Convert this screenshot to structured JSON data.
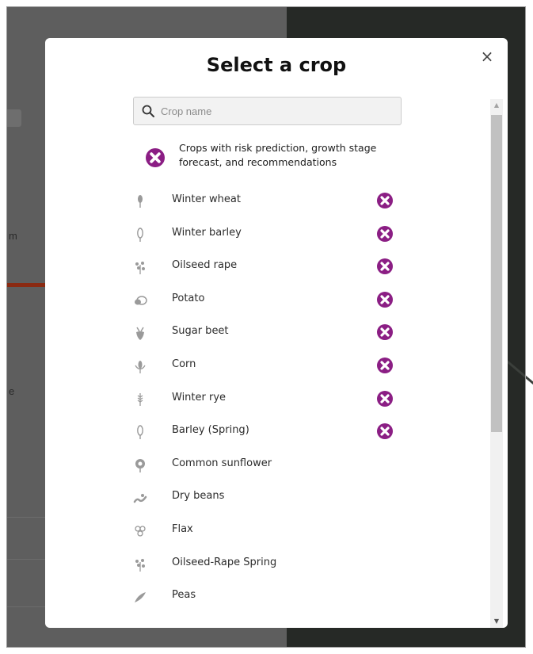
{
  "modal": {
    "title": "Select a crop",
    "close_label": "×",
    "search": {
      "placeholder": "Crop name",
      "value": ""
    },
    "legend_text": "Crops with risk prediction, growth stage forecast, and recommendations",
    "crops": [
      {
        "label": "Winter wheat",
        "icon": "wheat-icon",
        "badge": true
      },
      {
        "label": "Winter barley",
        "icon": "barley-icon",
        "badge": true
      },
      {
        "label": "Oilseed rape",
        "icon": "oilseed-rape-icon",
        "badge": true
      },
      {
        "label": "Potato",
        "icon": "potato-icon",
        "badge": true
      },
      {
        "label": "Sugar beet",
        "icon": "sugar-beet-icon",
        "badge": true
      },
      {
        "label": "Corn",
        "icon": "corn-icon",
        "badge": true
      },
      {
        "label": "Winter rye",
        "icon": "rye-icon",
        "badge": true
      },
      {
        "label": "Barley (Spring)",
        "icon": "barley-icon",
        "badge": true
      },
      {
        "label": "Common sunflower",
        "icon": "sunflower-icon",
        "badge": false
      },
      {
        "label": "Dry beans",
        "icon": "beans-icon",
        "badge": false
      },
      {
        "label": "Flax",
        "icon": "flax-icon",
        "badge": false
      },
      {
        "label": "Oilseed-Rape Spring",
        "icon": "oilseed-rape-icon",
        "badge": false
      },
      {
        "label": "Peas",
        "icon": "peas-icon",
        "badge": false
      }
    ]
  },
  "background": {
    "edge_text_1": "m",
    "edge_text_2": "e"
  },
  "colors": {
    "badge": "#8b1e84",
    "icon_gray": "#9a9a9a",
    "scroll_thumb": "#c1c1c1"
  }
}
